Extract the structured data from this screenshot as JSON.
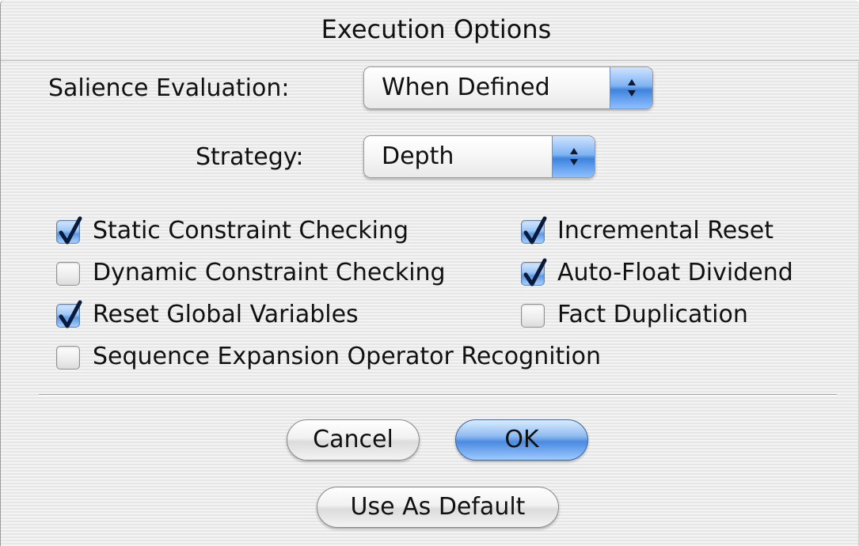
{
  "window": {
    "title": "Execution Options"
  },
  "form": {
    "salience_label": "Salience Evaluation:",
    "salience_value": "When Defined",
    "strategy_label": "Strategy:",
    "strategy_value": "Depth"
  },
  "checkboxes": [
    {
      "label": "Static Constraint Checking",
      "checked": true
    },
    {
      "label": "Dynamic Constraint Checking",
      "checked": false
    },
    {
      "label": "Reset Global Variables",
      "checked": true
    },
    {
      "label": "Sequence Expansion Operator Recognition",
      "checked": false
    },
    {
      "label": "Incremental Reset",
      "checked": true
    },
    {
      "label": "Auto-Float Dividend",
      "checked": true
    },
    {
      "label": "Fact Duplication",
      "checked": false
    }
  ],
  "buttons": {
    "cancel": "Cancel",
    "ok": "OK",
    "use_as_default": "Use As Default"
  },
  "colors": {
    "accent": "#4b8ae0",
    "checkmark": "#0a1a3a"
  },
  "icons": {
    "popup_arrows": "up-down-chevrons-icon",
    "check": "checkmark-icon"
  }
}
